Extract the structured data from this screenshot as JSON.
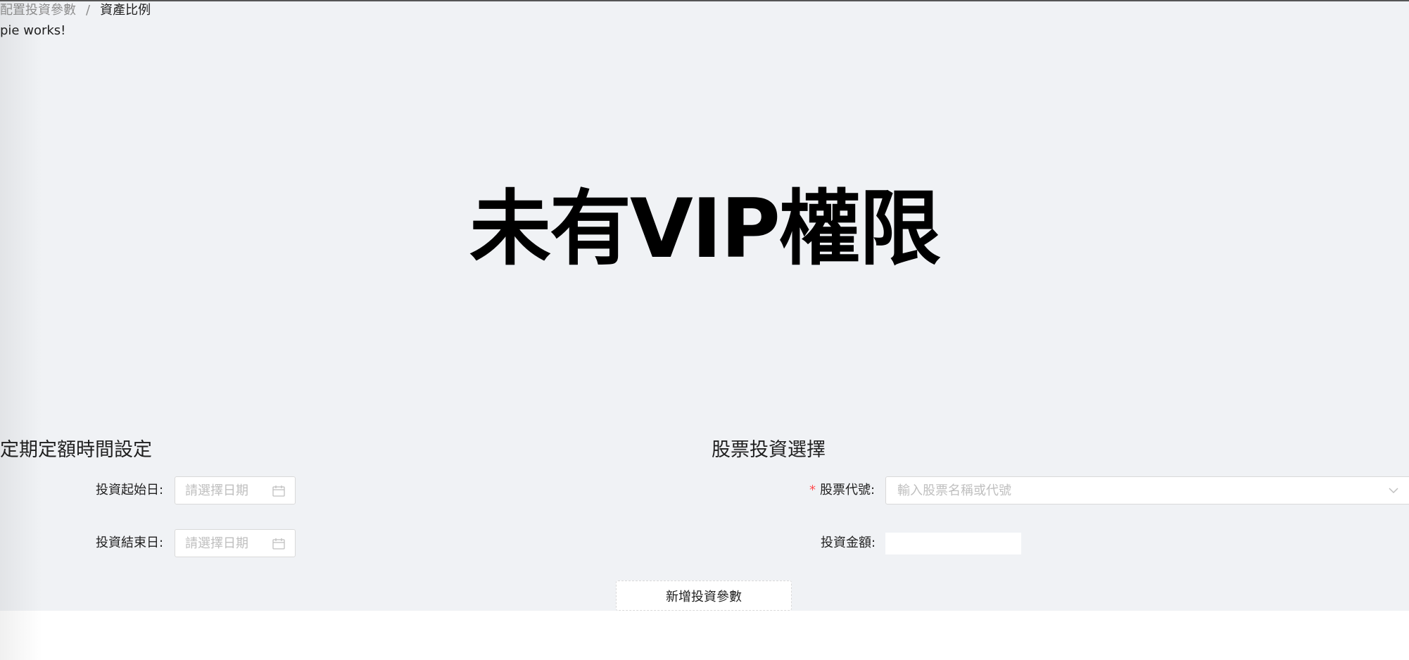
{
  "breadcrumb": {
    "parent": "配置投資參數",
    "separator": "/",
    "current": "資產比例"
  },
  "pie_placeholder": "pie works!",
  "vip_notice": "未有VIP權限",
  "dca_section": {
    "title": "定期定額時間設定",
    "start_label": "投資起始日",
    "start_placeholder": "請選擇日期",
    "end_label": "投資結束日",
    "end_placeholder": "請選擇日期"
  },
  "stock_section": {
    "title": "股票投資選擇",
    "required_mark": "*",
    "code_label": "股票代號",
    "code_placeholder": "輸入股票名稱或代號",
    "amount_label": "投資金額",
    "amount_value": ""
  },
  "add_button_label": "新增投資參數",
  "label_suffix": ":",
  "icons": {
    "date_picker": "calendar-icon",
    "select": "chevron-down-icon"
  },
  "colors": {
    "required": "#ff4d4f",
    "placeholder": "#bfbfbf",
    "panel": "#f0f2f5"
  }
}
